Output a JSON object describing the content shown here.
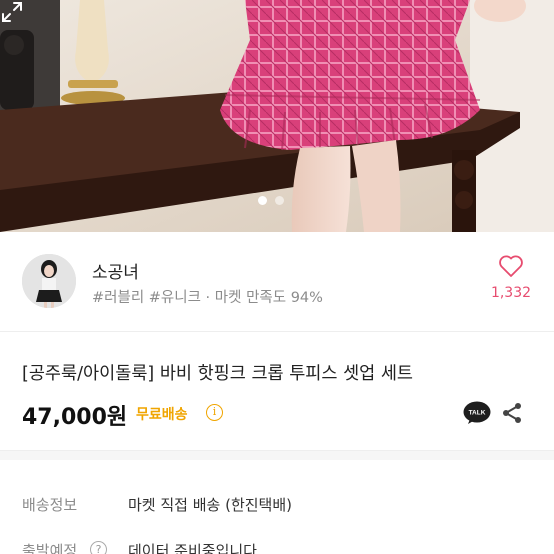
{
  "product_image": {
    "slide_count": 2,
    "active_index": 0,
    "expand_icon": "expand-icon"
  },
  "seller": {
    "name": "소공녀",
    "meta": "#러블리 #유니크 · 마켓 만족도 94%",
    "likes": "1,332",
    "like_icon": "heart-outline-icon"
  },
  "product": {
    "title": "[공주룩/아이돌룩] 바비 핫핑크 크롭 투피스 셋업 세트",
    "price": "47,000원",
    "shipping_badge": "무료배송",
    "info_glyph": "i",
    "talk_label": "TALK",
    "share_icon": "share-icon"
  },
  "delivery": {
    "info_label": "배송정보",
    "info_value": "마켓 직접 배송 (한진택배)",
    "date_label": "출발예정",
    "date_help_glyph": "?",
    "date_value": "데이터 준비중입니다"
  },
  "colors": {
    "accent_pink": "#e74c6f",
    "shipping_orange": "#f0a500",
    "muted_text": "#8c8c8c",
    "skirt_pink": "#d9407a"
  }
}
